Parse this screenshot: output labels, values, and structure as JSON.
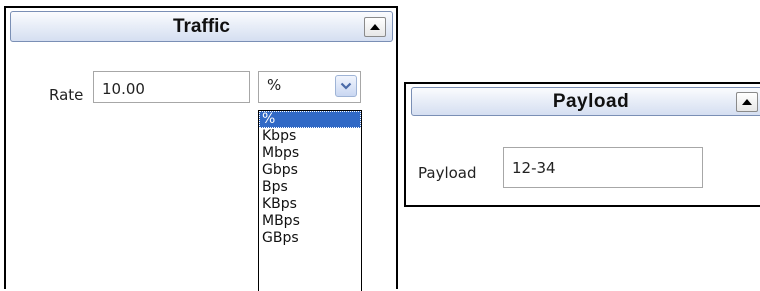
{
  "traffic_panel": {
    "title": "Traffic",
    "rate_label": "Rate",
    "rate_value": "10.00",
    "unit_select": {
      "selected": "%",
      "options": [
        "%",
        "Kbps",
        "Mbps",
        "Gbps",
        "Bps",
        "KBps",
        "MBps",
        "GBps"
      ],
      "highlighted_index": 0
    }
  },
  "payload_panel": {
    "title": "Payload",
    "payload_label": "Payload",
    "payload_value": "12-34"
  },
  "icons": {
    "collapse": "arrow-up-icon",
    "dropdown": "chevron-down-icon"
  },
  "colors": {
    "header_gradient_bottom": "#d5dff1",
    "selection_highlight": "#3169c6",
    "panel_border": "#000000"
  }
}
